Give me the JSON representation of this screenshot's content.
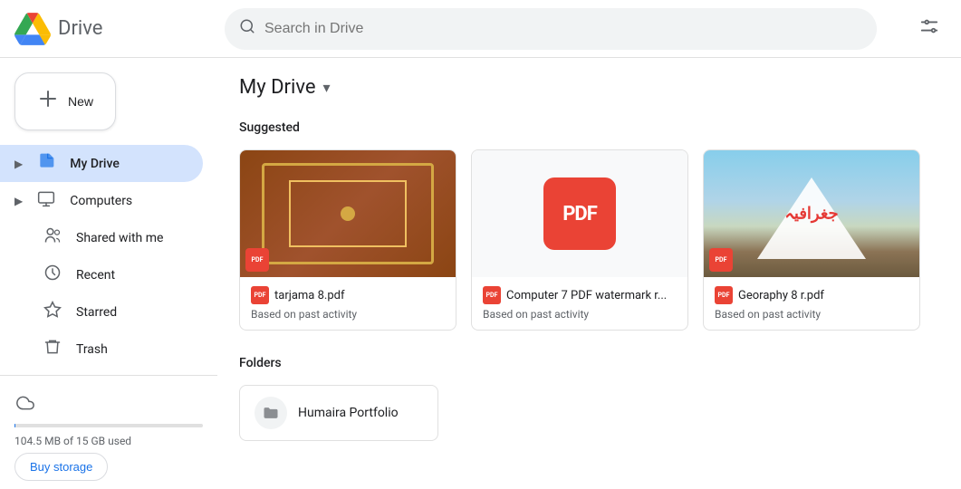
{
  "app": {
    "name": "Drive",
    "logo_alt": "Google Drive"
  },
  "topbar": {
    "search_placeholder": "Search in Drive",
    "settings_icon": "tune-icon"
  },
  "sidebar": {
    "new_button_label": "New",
    "nav_items": [
      {
        "id": "my-drive",
        "label": "My Drive",
        "icon": "drive-icon",
        "active": true,
        "expandable": true
      },
      {
        "id": "computers",
        "label": "Computers",
        "icon": "computer-icon",
        "active": false,
        "expandable": true
      },
      {
        "id": "shared-with-me",
        "label": "Shared with me",
        "icon": "people-icon",
        "active": false,
        "expandable": false
      },
      {
        "id": "recent",
        "label": "Recent",
        "icon": "clock-icon",
        "active": false,
        "expandable": false
      },
      {
        "id": "starred",
        "label": "Starred",
        "icon": "star-icon",
        "active": false,
        "expandable": false
      },
      {
        "id": "trash",
        "label": "Trash",
        "icon": "trash-icon",
        "active": false,
        "expandable": false
      }
    ],
    "storage": {
      "label": "104.5 MB of 15 GB used",
      "used_mb": 104.5,
      "total_gb": 15,
      "percent": 0.68,
      "buy_button": "Buy storage"
    }
  },
  "content": {
    "title": "My Drive",
    "chevron": "▾",
    "suggested_label": "Suggested",
    "folders_label": "Folders",
    "suggested_files": [
      {
        "id": "file-1",
        "name": "tarjama 8.pdf",
        "sub": "Based on past activity",
        "thumb_type": "ornament"
      },
      {
        "id": "file-2",
        "name": "Computer 7 PDF watermark r...",
        "sub": "Based on past activity",
        "thumb_type": "pdf"
      },
      {
        "id": "file-3",
        "name": "Georaphy 8 r.pdf",
        "sub": "Based on past activity",
        "thumb_type": "mountain"
      }
    ],
    "folders": [
      {
        "id": "folder-1",
        "name": "Humaira Portfolio"
      }
    ]
  },
  "icons": {
    "search": "🔍",
    "tune": "⊞",
    "drive": "📁",
    "computer": "💻",
    "people": "👥",
    "clock": "🕐",
    "star": "☆",
    "trash": "🗑",
    "cloud": "☁",
    "folder": "📁",
    "pdf_text": "PDF"
  }
}
